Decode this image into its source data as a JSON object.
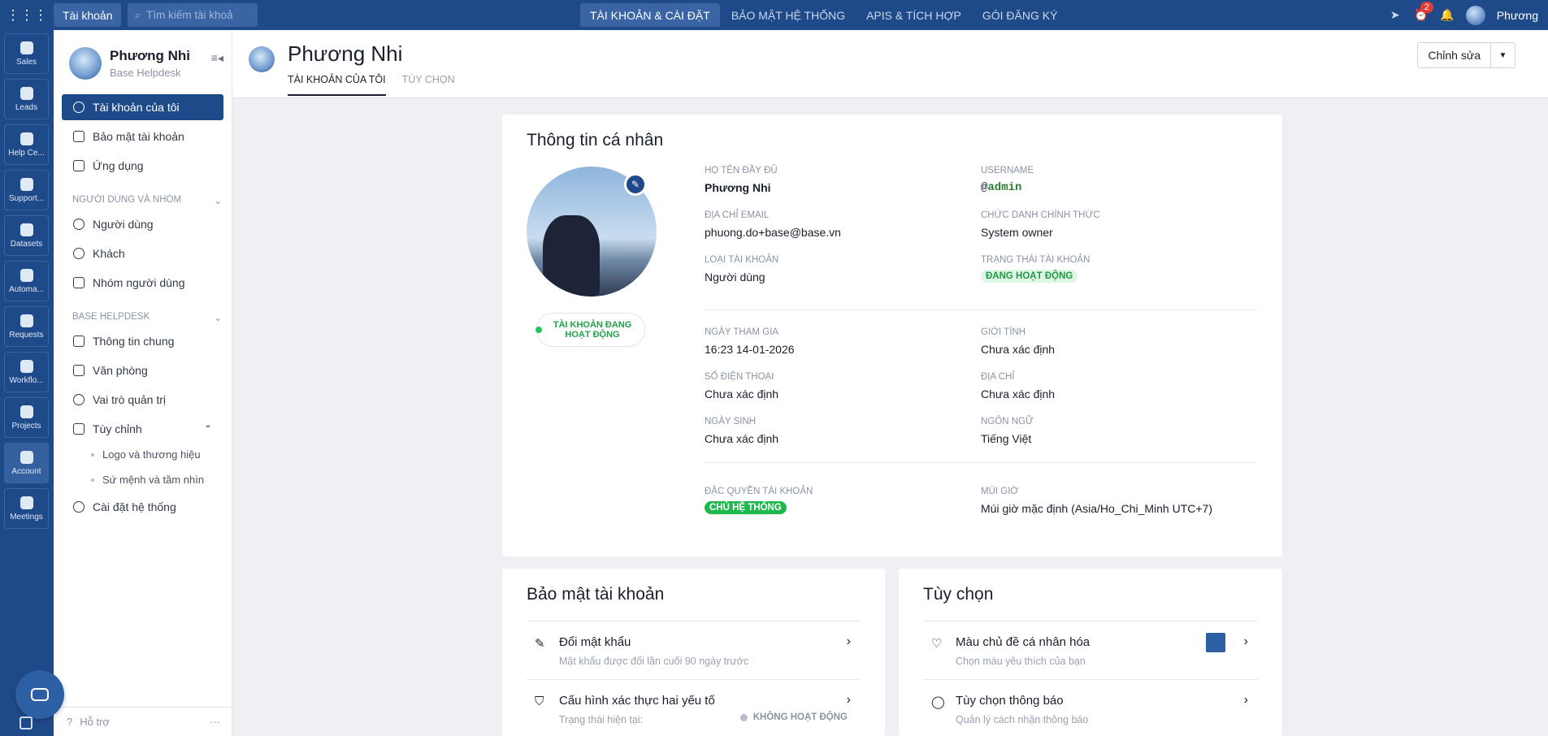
{
  "topbar": {
    "account_label": "Tài khoản",
    "search_placeholder": "Tìm kiếm tài khoả",
    "nav": [
      "TÀI KHOẢN & CÀI ĐẶT",
      "BẢO MẬT HỆ THỐNG",
      "APIS & TÍCH HỢP",
      "GÓI ĐĂNG KÝ"
    ],
    "notification_count": "2",
    "user_name": "Phương"
  },
  "rail": [
    "Sales",
    "Leads",
    "Help Ce...",
    "Support...",
    "Datasets",
    "Automa...",
    "Requests",
    "Workflo...",
    "Projects",
    "Account",
    "Meetings"
  ],
  "sidebar": {
    "name": "Phương Nhi",
    "org": "Base Helpdesk",
    "items": [
      "Tài khoản của tôi",
      "Bảo mật tài khoản",
      "Ứng dụng"
    ],
    "section1": "NGƯỜI DÙNG VÀ NHÓM",
    "section1_items": [
      "Người dùng",
      "Khách",
      "Nhóm người dùng"
    ],
    "section2": "BASE HELPDESK",
    "section2_items": [
      "Thông tin chung",
      "Văn phòng",
      "Vai trò quản trị",
      "Tùy chỉnh"
    ],
    "sub_items": [
      "Logo và thương hiệu",
      "Sứ mệnh và tầm nhìn"
    ],
    "last_item": "Cài đặt hệ thống",
    "footer": "Hỗ trợ"
  },
  "header": {
    "title": "Phương Nhi",
    "tabs": [
      "TÀI KHOẢN CỦA TÔI",
      "TÙY CHỌN"
    ],
    "edit_label": "Chỉnh sửa"
  },
  "profile": {
    "title": "Thông tin cá nhân",
    "status": "TÀI KHOẢN ĐANG HOẠT ĐỘNG",
    "fields": {
      "fullname_label": "HỌ TÊN ĐẦY ĐỦ",
      "fullname": "Phương Nhi",
      "username_label": "USERNAME",
      "username_at": "@",
      "username": "admin",
      "email_label": "ĐỊA CHỈ EMAIL",
      "email": "phuong.do+base@base.vn",
      "jobtitle_label": "CHỨC DANH CHÍNH THỨC",
      "jobtitle": "System owner",
      "acctype_label": "LOẠI TÀI KHOẢN",
      "acctype": "Người dùng",
      "accstatus_label": "TRẠNG THÁI TÀI KHOẢN",
      "accstatus": "ĐANG HOẠT ĐỘNG",
      "joined_label": "NGÀY THAM GIA",
      "joined": "16:23 14-01-2026",
      "gender_label": "GIỚI TÍNH",
      "gender": "Chưa xác định",
      "phone_label": "SỐ ĐIỆN THOẠI",
      "phone": "Chưa xác định",
      "address_label": "ĐỊA CHỈ",
      "address": "Chưa xác định",
      "dob_label": "NGÀY SINH",
      "dob": "Chưa xác định",
      "lang_label": "NGÔN NGỮ",
      "lang": "Tiếng Việt",
      "priv_label": "ĐẶC QUYỀN TÀI KHOẢN",
      "priv": "CHỦ HỆ THỐNG",
      "tz_label": "MÚI GIỜ",
      "tz": "Múi giờ mặc định (Asia/Ho_Chi_Minh UTC+7)"
    }
  },
  "security": {
    "title": "Bảo mật tài khoản",
    "rows": [
      {
        "title": "Đổi mật khẩu",
        "sub": "Mật khẩu được đổi lần cuối 90 ngày trước"
      },
      {
        "title": "Cấu hình xác thực hai yếu tố",
        "sub": "Trạng thái hiện tại:",
        "status": "KHÔNG HOẠT ĐỘNG"
      }
    ]
  },
  "options": {
    "title": "Tùy chọn",
    "rows": [
      {
        "title": "Màu chủ đề cá nhân hóa",
        "sub": "Chọn màu yêu thích của bạn"
      },
      {
        "title": "Tùy chọn thông báo",
        "sub": "Quản lý cách nhận thông báo"
      }
    ]
  },
  "colors": {
    "brand": "#1f4a8a",
    "active_green": "#1fb84f",
    "theme_swatch": "#2d5fa4"
  }
}
